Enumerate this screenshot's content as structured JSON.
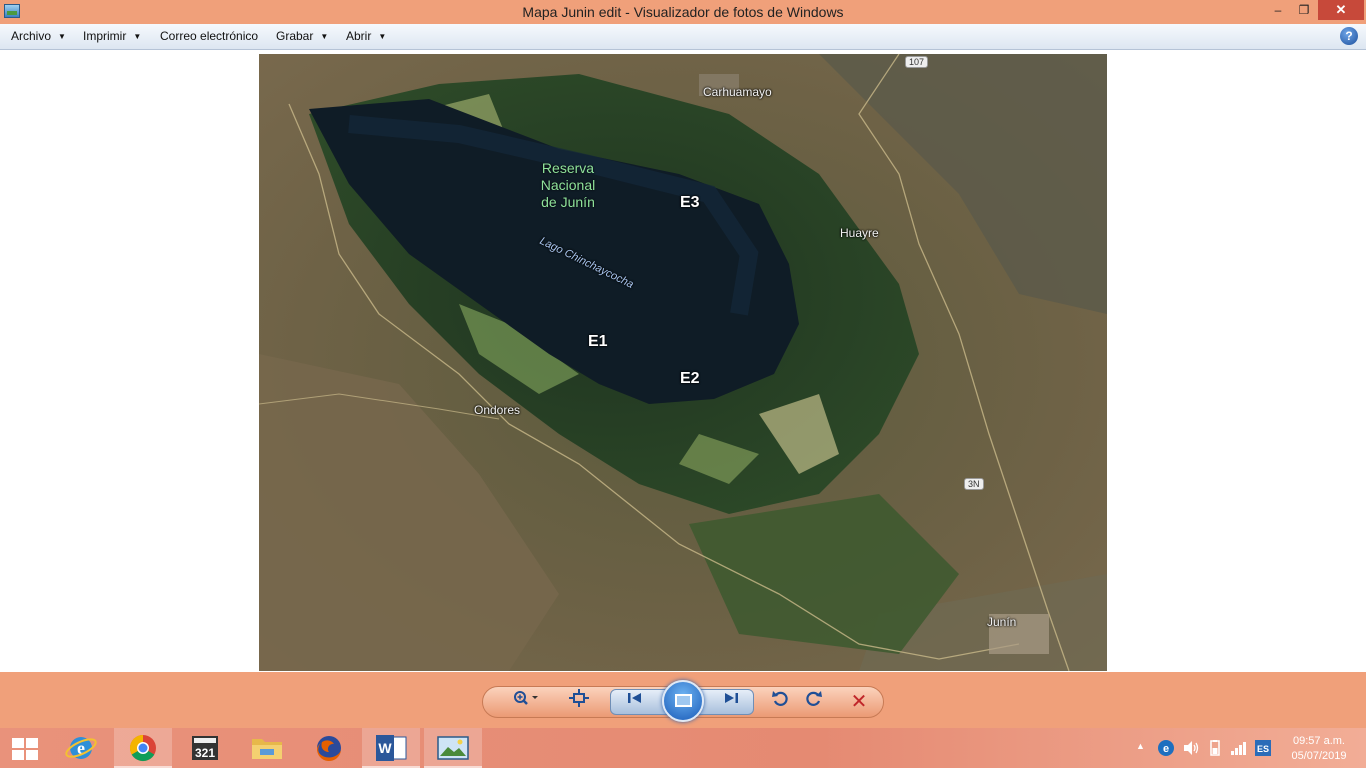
{
  "window": {
    "title": "Mapa Junin edit - Visualizador de fotos de Windows",
    "minimize": "–",
    "maximize": "❐",
    "close": "✕"
  },
  "menu": {
    "items": [
      {
        "label": "Archivo",
        "has_dropdown": true
      },
      {
        "label": "Imprimir",
        "has_dropdown": true
      },
      {
        "label": "Correo electrónico",
        "has_dropdown": false
      },
      {
        "label": "Grabar",
        "has_dropdown": true
      },
      {
        "label": "Abrir",
        "has_dropdown": true
      }
    ],
    "help": "?"
  },
  "map": {
    "reserve_label": "Reserva Nacional de Junín",
    "lake_label": "Lago Chinchaycocha",
    "towns": {
      "carhuamayo": "Carhuamayo",
      "huayre": "Huayre",
      "ondores": "Ondores",
      "junin": "Junín"
    },
    "roads": {
      "north": "107",
      "east": "3N"
    },
    "stations": {
      "e1": "E1",
      "e2": "E2",
      "e3": "E3"
    }
  },
  "controls": {
    "zoom": "zoom-icon",
    "fit": "fit-window-icon",
    "previous": "previous-icon",
    "slideshow": "slideshow-icon",
    "next": "next-icon",
    "rotate_left": "rotate-left-icon",
    "rotate_right": "rotate-right-icon",
    "delete": "delete-icon"
  },
  "taskbar": {
    "apps": [
      "internet-explorer-icon",
      "chrome-icon",
      "media-player-classic-icon",
      "file-explorer-icon",
      "firefox-icon",
      "word-icon",
      "photo-viewer-icon"
    ],
    "clock_time": "09:57 a.m.",
    "clock_date": "05/07/2019"
  },
  "colors": {
    "accent": "#f0a07a",
    "taskbar": "#e58a72",
    "close_button": "#c7493a",
    "delete_icon": "#c0262a"
  }
}
